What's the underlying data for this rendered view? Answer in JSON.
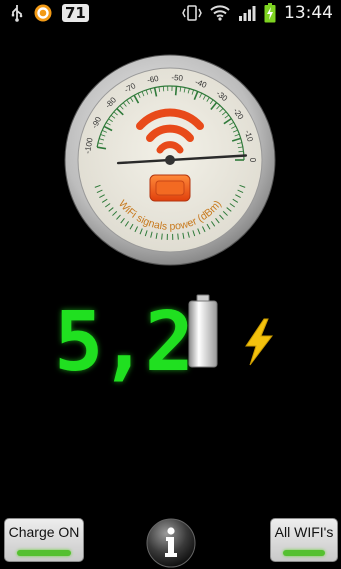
{
  "status_bar": {
    "usb_icon": "usb-icon",
    "notification_icon": "orange-app-icon",
    "badge_count": "71",
    "clock": "13:44",
    "icons": [
      "vibrate-icon",
      "wifi-icon",
      "signal-icon",
      "battery-charging-icon"
    ]
  },
  "gauge": {
    "label": "WiFi signals power (dBm)",
    "scale_labels": [
      "-100",
      "-90",
      "-80",
      "-70",
      "-60",
      "-50",
      "-40",
      "-30",
      "-20",
      "-10",
      "0"
    ],
    "needle_value": -2,
    "wifi_icon": "wifi-icon",
    "indicator_icon": "signal-indicator-icon",
    "colors": {
      "wifi_icon": "#e84a1a",
      "scale": "#2f7a3a",
      "label": "#c87a1e"
    }
  },
  "reading": {
    "value": "5,2",
    "battery_icon": "battery-icon",
    "charge_icon": "lightning-icon",
    "color": "#20e020"
  },
  "buttons": {
    "charge_label": "Charge ON",
    "all_wifi_label": "All WIFI's",
    "info_icon": "info-icon"
  }
}
